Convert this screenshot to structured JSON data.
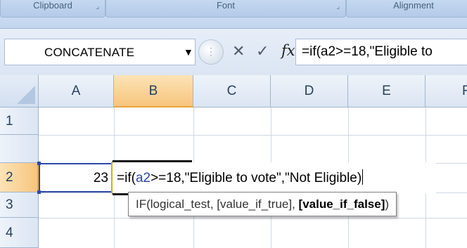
{
  "ribbon": {
    "groups": [
      {
        "label": "Clipboard"
      },
      {
        "label": "Font"
      },
      {
        "label": "Alignment"
      }
    ]
  },
  "formula_bar": {
    "name_box": "CONCATENATE",
    "cancel_symbol": "✕",
    "enter_symbol": "✓",
    "fx_label": "fx",
    "formula": "=if(a2>=18,\"Eligible to"
  },
  "sheet": {
    "columns": [
      "A",
      "B",
      "C",
      "D",
      "E",
      "F"
    ],
    "active_column": "B",
    "rows": [
      "1",
      "2",
      "3",
      "4"
    ],
    "active_row": "2",
    "cells": {
      "A2": "23"
    },
    "editing_cell": "B2",
    "editor": {
      "prefix": "=if(",
      "ref": "a2",
      "suffix": ">=18,\"Eligible to vote\",\"Not Eligible)"
    },
    "tooltip": {
      "fn": "IF(",
      "arg1": "logical_test, ",
      "arg2": "[value_if_true], ",
      "arg3": "[value_if_false]",
      "close": ")"
    }
  },
  "colors": {
    "active_header": "#f7c57d",
    "selection_border": "#2e49a8",
    "ribbon": "#c2d5ee"
  }
}
